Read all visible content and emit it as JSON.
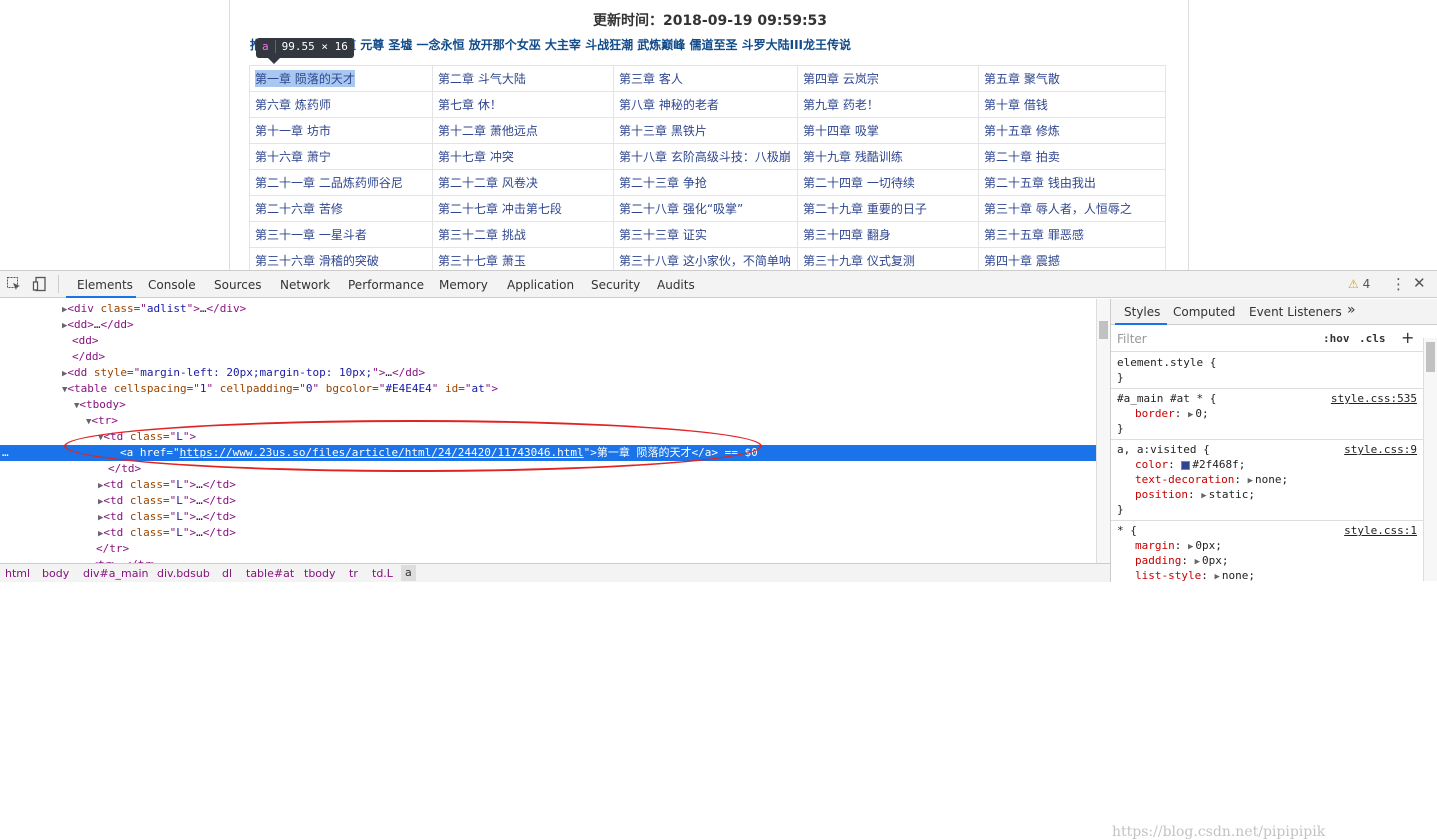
{
  "page": {
    "update_time": "更新时间：2018-09-19 09:59:53",
    "related_prefix": "推",
    "related_links": "道 元尊 圣墟 一念永恒 放开那个女巫 大主宰 斗战狂潮 武炼巅峰 儒道至圣 斗罗大陆III龙王传说",
    "tooltip": {
      "tag": "a",
      "size": "99.55 × 16"
    },
    "chapters": [
      [
        "第一章 陨落的天才",
        "第二章 斗气大陆",
        "第三章 客人",
        "第四章 云岚宗",
        "第五章 聚气散"
      ],
      [
        "第六章 炼药师",
        "第七章 休！",
        "第八章 神秘的老者",
        "第九章 药老！",
        "第十章 借钱"
      ],
      [
        "第十一章 坊市",
        "第十二章 萧他远点",
        "第十三章 黑铁片",
        "第十四章 吸掌",
        "第十五章 修炼"
      ],
      [
        "第十六章 萧宁",
        "第十七章 冲突",
        "第十八章 玄阶高级斗技：八极崩",
        "第十九章 残酷训练",
        "第二十章 拍卖"
      ],
      [
        "第二十一章 二品炼药师谷尼",
        "第二十二章 风卷决",
        "第二十三章 争抢",
        "第二十四章 一切待续",
        "第二十五章 钱由我出"
      ],
      [
        "第二十六章 苦修",
        "第二十七章 冲击第七段",
        "第二十八章 强化“吸掌”",
        "第二十九章 重要的日子",
        "第三十章 辱人者，人恒辱之"
      ],
      [
        "第三十一章 一星斗者",
        "第三十二章 挑战",
        "第三十三章 证实",
        "第三十四章 翻身",
        "第三十五章 罪恶感"
      ],
      [
        "第三十六章 滑稽的突破",
        "第三十七章 萧玉",
        "第三十八章 这小家伙，不简单呐",
        "第三十九章 仪式复测",
        "第四十章 震撼"
      ]
    ]
  },
  "devtools": {
    "tabs": [
      "Elements",
      "Console",
      "Sources",
      "Network",
      "Performance",
      "Memory",
      "Application",
      "Security",
      "Audits"
    ],
    "active_tab": "Elements",
    "warning_count": "4",
    "dom_lines": [
      {
        "indent": 62,
        "parts": [
          [
            "tri",
            "▶"
          ],
          [
            "tg",
            "<div "
          ],
          [
            "at",
            "class"
          ],
          [
            "tg",
            "=\""
          ],
          [
            "av",
            "adlist"
          ],
          [
            "tg",
            "\">"
          ],
          [
            "tx",
            "…"
          ],
          [
            "tg",
            "</div>"
          ]
        ]
      },
      {
        "indent": 62,
        "parts": [
          [
            "tri",
            "▶"
          ],
          [
            "tg",
            "<dd>"
          ],
          [
            "tx",
            "…"
          ],
          [
            "tg",
            "</dd>"
          ]
        ]
      },
      {
        "indent": 72,
        "parts": [
          [
            "tg",
            "<dd>"
          ]
        ]
      },
      {
        "indent": 72,
        "parts": [
          [
            "tg",
            "</dd>"
          ]
        ]
      },
      {
        "indent": 62,
        "parts": [
          [
            "tri",
            "▶"
          ],
          [
            "tg",
            "<dd "
          ],
          [
            "at",
            "style"
          ],
          [
            "tg",
            "=\""
          ],
          [
            "av",
            "margin-left: 20px;margin-top: 10px;"
          ],
          [
            "tg",
            "\">"
          ],
          [
            "tx",
            "…"
          ],
          [
            "tg",
            "</dd>"
          ]
        ]
      },
      {
        "indent": 62,
        "parts": [
          [
            "tri",
            "▼"
          ],
          [
            "tg",
            "<table "
          ],
          [
            "at",
            "cellspacing"
          ],
          [
            "tg",
            "=\""
          ],
          [
            "av",
            "1"
          ],
          [
            "tg",
            "\" "
          ],
          [
            "at",
            "cellpadding"
          ],
          [
            "tg",
            "=\""
          ],
          [
            "av",
            "0"
          ],
          [
            "tg",
            "\" "
          ],
          [
            "at",
            "bgcolor"
          ],
          [
            "tg",
            "=\""
          ],
          [
            "av",
            "#E4E4E4"
          ],
          [
            "tg",
            "\" "
          ],
          [
            "at",
            "id"
          ],
          [
            "tg",
            "=\""
          ],
          [
            "av",
            "at"
          ],
          [
            "tg",
            "\">"
          ]
        ]
      },
      {
        "indent": 74,
        "parts": [
          [
            "tri",
            "▼"
          ],
          [
            "tg",
            "<tbody>"
          ]
        ]
      },
      {
        "indent": 86,
        "parts": [
          [
            "tri",
            "▼"
          ],
          [
            "tg",
            "<tr>"
          ]
        ]
      },
      {
        "indent": 98,
        "parts": [
          [
            "tri",
            "▼"
          ],
          [
            "tg",
            "<td "
          ],
          [
            "at",
            "class"
          ],
          [
            "tg",
            "=\""
          ],
          [
            "av",
            "L"
          ],
          [
            "tg",
            "\">"
          ]
        ]
      },
      {
        "indent": 120,
        "selected": true,
        "parts": [
          [
            "tg",
            "<a "
          ],
          [
            "at",
            "href"
          ],
          [
            "tg",
            "=\""
          ],
          [
            "av",
            "https://www.23us.so/files/article/html/24/24420/11743046.html"
          ],
          [
            "tg",
            "\">"
          ],
          [
            "tx",
            "第一章 陨落的天才"
          ],
          [
            "tg",
            "</a>"
          ],
          [
            "tx",
            " == $0"
          ]
        ]
      },
      {
        "indent": 108,
        "parts": [
          [
            "tg",
            "</td>"
          ]
        ]
      },
      {
        "indent": 98,
        "parts": [
          [
            "tri",
            "▶"
          ],
          [
            "tg",
            "<td "
          ],
          [
            "at",
            "class"
          ],
          [
            "tg",
            "=\""
          ],
          [
            "av",
            "L"
          ],
          [
            "tg",
            "\">"
          ],
          [
            "tx",
            "…"
          ],
          [
            "tg",
            "</td>"
          ]
        ]
      },
      {
        "indent": 98,
        "parts": [
          [
            "tri",
            "▶"
          ],
          [
            "tg",
            "<td "
          ],
          [
            "at",
            "class"
          ],
          [
            "tg",
            "=\""
          ],
          [
            "av",
            "L"
          ],
          [
            "tg",
            "\">"
          ],
          [
            "tx",
            "…"
          ],
          [
            "tg",
            "</td>"
          ]
        ]
      },
      {
        "indent": 98,
        "parts": [
          [
            "tri",
            "▶"
          ],
          [
            "tg",
            "<td "
          ],
          [
            "at",
            "class"
          ],
          [
            "tg",
            "=\""
          ],
          [
            "av",
            "L"
          ],
          [
            "tg",
            "\">"
          ],
          [
            "tx",
            "…"
          ],
          [
            "tg",
            "</td>"
          ]
        ]
      },
      {
        "indent": 98,
        "parts": [
          [
            "tri",
            "▶"
          ],
          [
            "tg",
            "<td "
          ],
          [
            "at",
            "class"
          ],
          [
            "tg",
            "=\""
          ],
          [
            "av",
            "L"
          ],
          [
            "tg",
            "\">"
          ],
          [
            "tx",
            "…"
          ],
          [
            "tg",
            "</td>"
          ]
        ]
      },
      {
        "indent": 96,
        "parts": [
          [
            "tg",
            "</tr>"
          ]
        ]
      },
      {
        "indent": 86,
        "parts": [
          [
            "tri",
            "▶"
          ],
          [
            "tg",
            "<tr>"
          ],
          [
            "tx",
            "…"
          ],
          [
            "tg",
            "</tr>"
          ]
        ]
      }
    ],
    "breadcrumb": [
      "html",
      "body",
      "div#a_main",
      "div.bdsub",
      "dl",
      "table#at",
      "tbody",
      "tr",
      "td.L",
      "a"
    ],
    "styles_tabs": [
      "Styles",
      "Computed",
      "Event Listeners",
      "»"
    ],
    "filter_placeholder": "Filter",
    "hov": ":hov",
    "cls": ".cls",
    "plus": "+",
    "rules": [
      {
        "selector": "element.style {",
        "source": "",
        "props": [],
        "close": "}"
      },
      {
        "selector": "#a_main #at * {",
        "source": "style.css:535",
        "props": [
          {
            "name": "border",
            "value": "0;"
          }
        ],
        "close": "}"
      },
      {
        "selector": "a, a:visited {",
        "source": "style.css:9",
        "props": [
          {
            "name": "color",
            "value": "#2f468f;",
            "swatch": "#2f468f"
          },
          {
            "name": "text-decoration",
            "value": "none;"
          },
          {
            "name": "position",
            "value": "static;"
          }
        ],
        "close": "}"
      },
      {
        "selector": "* {",
        "source": "style.css:1",
        "props": [
          {
            "name": "margin",
            "value": "0px;"
          },
          {
            "name": "padding",
            "value": "0px;"
          },
          {
            "name": "list-style",
            "value": "none;"
          }
        ],
        "close": ""
      }
    ],
    "watermark": "https://blog.csdn.net/pipipipik"
  }
}
